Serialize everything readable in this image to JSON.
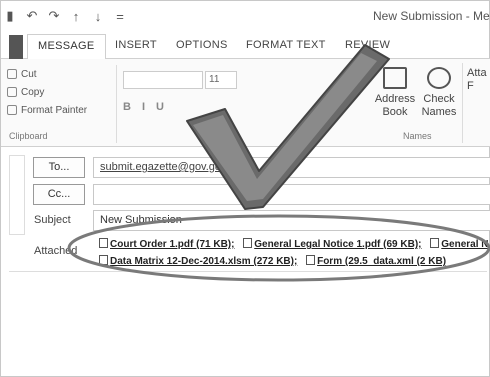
{
  "window": {
    "title": "New Submission - Mes"
  },
  "quick_access": [
    {
      "icon": "save-icon",
      "glyph": "▮"
    },
    {
      "icon": "undo-icon",
      "glyph": "↶"
    },
    {
      "icon": "redo-icon",
      "glyph": "↷"
    },
    {
      "icon": "up-arrow-icon",
      "glyph": "↑"
    },
    {
      "icon": "down-arrow-icon",
      "glyph": "↓"
    },
    {
      "icon": "customize-icon",
      "glyph": "="
    }
  ],
  "tabs": [
    {
      "label": "MESSAGE",
      "active": true
    },
    {
      "label": "INSERT",
      "active": false
    },
    {
      "label": "OPTIONS",
      "active": false
    },
    {
      "label": "FORMAT TEXT",
      "active": false
    },
    {
      "label": "REVIEW",
      "active": false
    }
  ],
  "ribbon": {
    "clipboard": {
      "cut": "Cut",
      "copy": "Copy",
      "format_painter": "Format Painter",
      "label": "Clipboard"
    },
    "font_size": "11",
    "format_buttons": [
      "B",
      "I",
      "U"
    ],
    "names": {
      "address_book": "Address Book",
      "check_names": "Check Names",
      "label": "Names"
    },
    "attach": "Atta F"
  },
  "compose": {
    "to_button": "To...",
    "cc_button": "Cc...",
    "to_value": "submit.egazette@gov.gd",
    "cc_value": "",
    "subject_label": "Subject",
    "subject_value": "New Submission",
    "attached_label": "Attached",
    "attachments_row1": [
      "Court Order 1.pdf (71 KB);",
      "General Legal Notice 1.pdf (69 KB);",
      "General N"
    ],
    "attachments_row2": [
      "Data Matrix 12-Dec-2014.xlsm (272 KB);",
      "Form (29.5_data.xml (2 KB)"
    ]
  },
  "colors": {
    "checkmark": "#6a6a6a",
    "highlight_ellipse": "#7a7a7a"
  }
}
